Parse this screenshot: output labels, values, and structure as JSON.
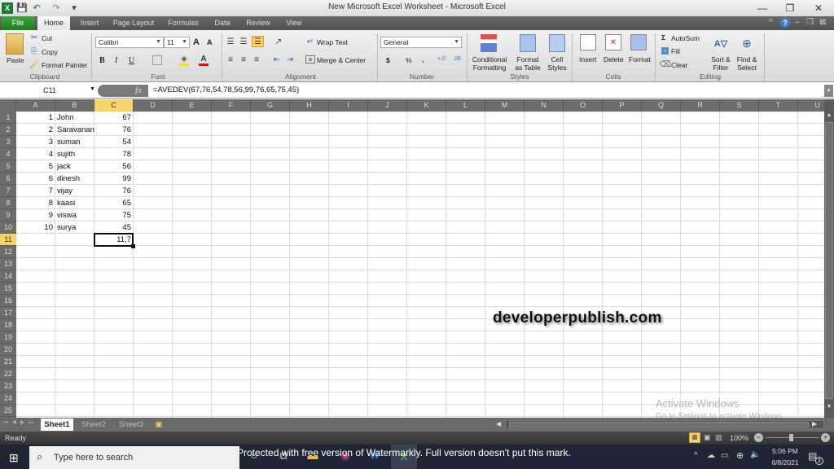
{
  "window": {
    "title": "New Microsoft Excel Worksheet  -  Microsoft Excel",
    "controls": {
      "minimize": "—",
      "restore": "❐",
      "close": "✕"
    }
  },
  "qat": {
    "save_icon": "💾",
    "undo_icon": "↶",
    "redo_icon": "↷",
    "customize_icon": "▾"
  },
  "tabs": [
    {
      "label": "File"
    },
    {
      "label": "Home"
    },
    {
      "label": "Insert"
    },
    {
      "label": "Page Layout"
    },
    {
      "label": "Formulas"
    },
    {
      "label": "Data"
    },
    {
      "label": "Review"
    },
    {
      "label": "View"
    }
  ],
  "ribbon": {
    "clipboard": {
      "paste": "Paste",
      "cut": "Cut",
      "copy": "Copy",
      "format_painter": "Format Painter",
      "label": "Clipboard"
    },
    "font": {
      "name": "Calibri",
      "size": "11",
      "bold": "B",
      "italic": "I",
      "underline": "U",
      "grow": "A",
      "shrink": "A",
      "label": "Font"
    },
    "alignment": {
      "wrap_text": "Wrap Text",
      "merge_center": "Merge & Center",
      "label": "Alignment"
    },
    "number": {
      "format": "General",
      "currency": "$",
      "percent": "%",
      "comma": ",",
      "inc_decimal": "+.0",
      "dec_decimal": ".00",
      "label": "Number"
    },
    "styles": {
      "conditional": [
        "Conditional",
        "Formatting"
      ],
      "as_table": [
        "Format",
        "as Table"
      ],
      "cell_styles": [
        "Cell",
        "Styles"
      ],
      "label": "Styles"
    },
    "cells": {
      "insert": "Insert",
      "delete": "Delete",
      "format": "Format",
      "label": "Cells"
    },
    "editing": {
      "autosum": "AutoSum",
      "fill": "Fill",
      "clear": "Clear",
      "sort_filter": [
        "Sort &",
        "Filter"
      ],
      "find_select": [
        "Find &",
        "Select"
      ],
      "label": "Editing"
    }
  },
  "formula_bar": {
    "name_box": "C11",
    "fx": "fx",
    "formula": "=AVEDEV(67,76,54,78,56,99,76,65,75,45)"
  },
  "columns": [
    "A",
    "B",
    "C",
    "D",
    "E",
    "F",
    "G",
    "H",
    "I",
    "J",
    "K",
    "L",
    "M",
    "N",
    "O",
    "P",
    "Q",
    "R",
    "S",
    "T",
    "U"
  ],
  "selected_column": "C",
  "rows": [
    "1",
    "2",
    "3",
    "4",
    "5",
    "6",
    "7",
    "8",
    "9",
    "10",
    "11",
    "12",
    "13",
    "14",
    "15",
    "16",
    "17",
    "18",
    "19",
    "20",
    "21",
    "22",
    "23",
    "24",
    "25"
  ],
  "selected_row": "11",
  "sheet_data": [
    {
      "a": "1",
      "b": "John",
      "c": "67"
    },
    {
      "a": "2",
      "b": "Saravanan",
      "c": "76"
    },
    {
      "a": "3",
      "b": "suman",
      "c": "54"
    },
    {
      "a": "4",
      "b": "sujith",
      "c": "78"
    },
    {
      "a": "5",
      "b": "jack",
      "c": "56"
    },
    {
      "a": "6",
      "b": "dinesh",
      "c": "99"
    },
    {
      "a": "7",
      "b": "vijay",
      "c": "76"
    },
    {
      "a": "8",
      "b": "kaasi",
      "c": "65"
    },
    {
      "a": "9",
      "b": "viswa",
      "c": "75"
    },
    {
      "a": "10",
      "b": "surya",
      "c": "45"
    }
  ],
  "result_cell": {
    "ref": "C11",
    "value": "11.7"
  },
  "overlay": {
    "site": "developerpublish.com",
    "activate_title": "Activate Windows",
    "activate_sub": "Go to Settings to activate Windows."
  },
  "sheets": [
    {
      "label": "Sheet1"
    },
    {
      "label": "Sheet2"
    },
    {
      "label": "Sheet3"
    }
  ],
  "status": {
    "mode": "Ready",
    "zoom": "100%"
  },
  "taskbar": {
    "search_placeholder": "Type here to search",
    "watermark": "Protected with free version of Watermarkly. Full version doesn't put this mark.",
    "time": "5:06 PM",
    "date": "6/8/2021",
    "notifications": "2"
  }
}
